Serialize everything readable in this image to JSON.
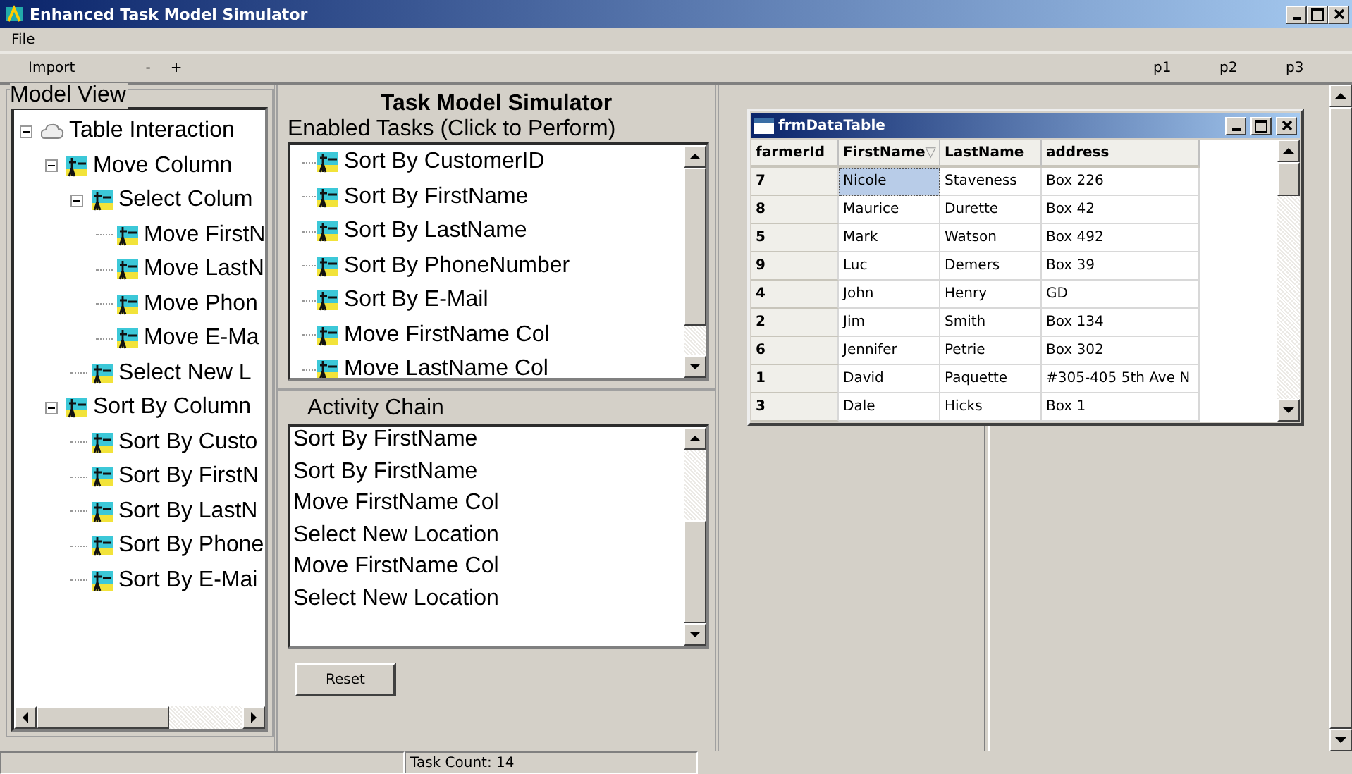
{
  "window": {
    "title": "Enhanced Task Model Simulator"
  },
  "menu": [
    "File"
  ],
  "toolbar": {
    "left": [
      "Import",
      "-",
      "+"
    ],
    "right": [
      "p1",
      "p2",
      "p3"
    ]
  },
  "model_view": {
    "title": "Model View",
    "tree": [
      {
        "label": "Table Interaction",
        "kind": "root",
        "expanded": true,
        "children": [
          {
            "label": "Move Column",
            "kind": "task",
            "expanded": true,
            "children": [
              {
                "label": "Select Colum",
                "kind": "task",
                "expanded": true,
                "children": [
                  {
                    "label": "Move FirstN",
                    "kind": "task"
                  },
                  {
                    "label": "Move LastN",
                    "kind": "task"
                  },
                  {
                    "label": "Move Phon",
                    "kind": "task"
                  },
                  {
                    "label": "Move E-Ma",
                    "kind": "task"
                  }
                ]
              },
              {
                "label": "Select New L",
                "kind": "task"
              }
            ]
          },
          {
            "label": "Sort By Column",
            "kind": "task",
            "expanded": true,
            "children": [
              {
                "label": "Sort By Custo",
                "kind": "task"
              },
              {
                "label": "Sort By FirstN",
                "kind": "task"
              },
              {
                "label": "Sort By LastN",
                "kind": "task"
              },
              {
                "label": "Sort By Phone",
                "kind": "task"
              },
              {
                "label": "Sort By E-Mai",
                "kind": "task"
              }
            ]
          }
        ]
      }
    ]
  },
  "simulator": {
    "title": "Task Model Simulator",
    "enabled_title": "Enabled Tasks (Click to Perform)",
    "enabled_tasks": [
      "Sort By CustomerID",
      "Sort By FirstName",
      "Sort By LastName",
      "Sort By PhoneNumber",
      "Sort By E-Mail",
      "Move FirstName Col",
      "Move LastName Col"
    ],
    "activity_title": "Activity Chain",
    "activity_chain": [
      "Sort By FirstName",
      "Sort By FirstName",
      "Move FirstName Col",
      "Select New Location",
      "Move FirstName Col",
      "Select New Location"
    ],
    "reset_button": "Reset"
  },
  "data_window": {
    "title": "frmDataTable",
    "columns": [
      {
        "label": "farmerId"
      },
      {
        "label": "FirstName",
        "sort_indicator": "▽"
      },
      {
        "label": "LastName"
      },
      {
        "label": "address"
      }
    ],
    "rows": [
      {
        "cells": [
          "7",
          "Nicole",
          "Staveness",
          "Box 226"
        ],
        "selected": true
      },
      {
        "cells": [
          "8",
          "Maurice",
          "Durette",
          "Box 42"
        ],
        "selected": false
      },
      {
        "cells": [
          "5",
          "Mark",
          "Watson",
          "Box 492"
        ],
        "selected": false
      },
      {
        "cells": [
          "9",
          "Luc",
          "Demers",
          "Box 39"
        ],
        "selected": false
      },
      {
        "cells": [
          "4",
          "John",
          "Henry",
          "GD"
        ],
        "selected": false
      },
      {
        "cells": [
          "2",
          "Jim",
          "Smith",
          "Box 134"
        ],
        "selected": false
      },
      {
        "cells": [
          "6",
          "Jennifer",
          "Petrie",
          "Box 302"
        ],
        "selected": false
      },
      {
        "cells": [
          "1",
          "David",
          "Paquette",
          "#305-405 5th Ave N"
        ],
        "selected": false
      },
      {
        "cells": [
          "3",
          "Dale",
          "Hicks",
          "Box 1"
        ],
        "selected": false
      }
    ]
  },
  "status_bar": {
    "task_count": "Task Count: 14"
  }
}
